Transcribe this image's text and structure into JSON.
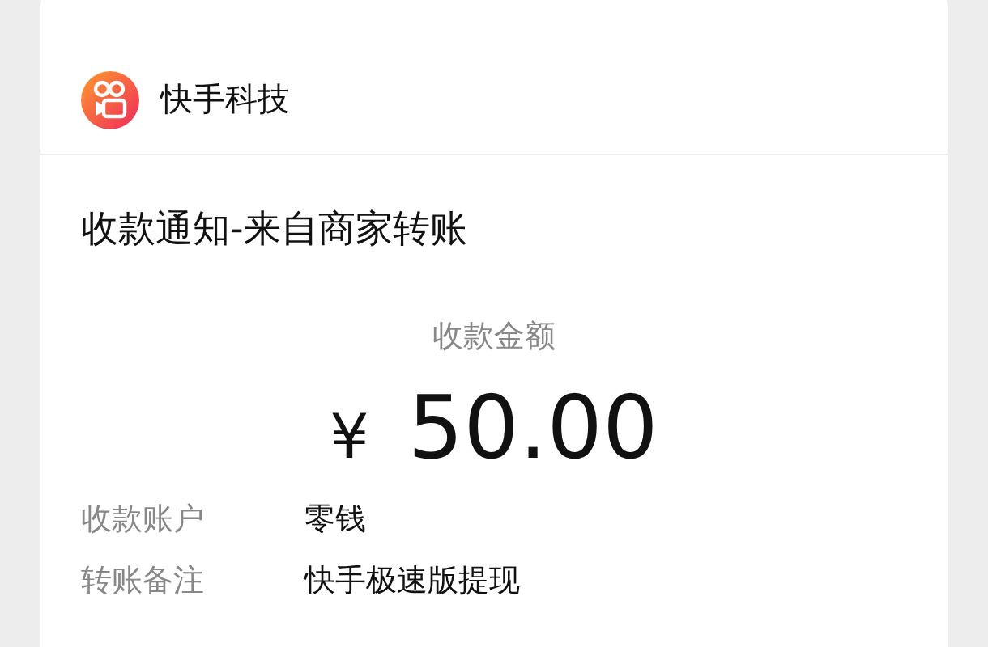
{
  "merchant": {
    "name": "快手科技"
  },
  "notice": {
    "title": "收款通知-来自商家转账",
    "amount_label": "收款金额",
    "currency": "¥",
    "amount": "50.00"
  },
  "details": [
    {
      "label": "收款账户",
      "value": "零钱"
    },
    {
      "label": "转账备注",
      "value": "快手极速版提现"
    }
  ]
}
